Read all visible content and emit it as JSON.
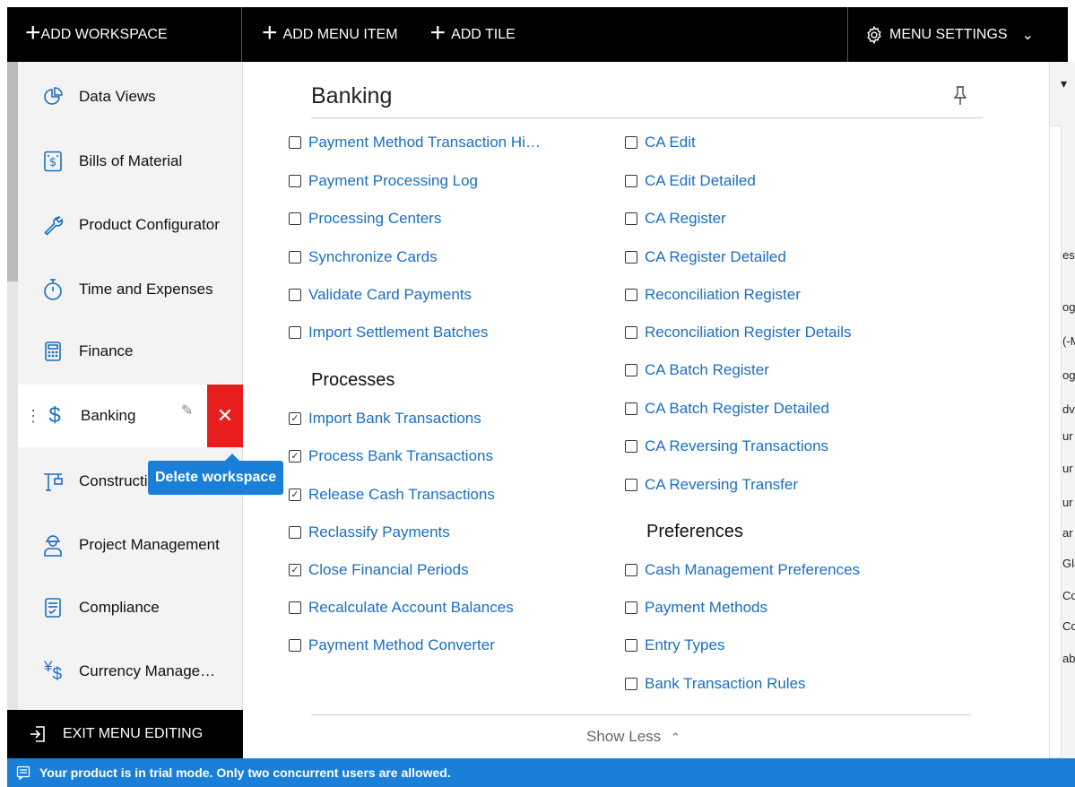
{
  "topbar": {
    "add_workspace": "ADD WORKSPACE",
    "add_menu_item": "ADD MENU ITEM",
    "add_tile": "ADD TILE",
    "menu_settings": "MENU SETTINGS"
  },
  "sidebar": {
    "items": [
      {
        "label": "Data Views",
        "icon": "pie-chart-icon"
      },
      {
        "label": "Bills of Material",
        "icon": "bill-icon"
      },
      {
        "label": "Product Configurator",
        "icon": "wrench-icon"
      },
      {
        "label": "Time and Expenses",
        "icon": "stopwatch-icon"
      },
      {
        "label": "Finance",
        "icon": "calculator-icon"
      },
      {
        "label": "Banking",
        "icon": "dollar-icon"
      },
      {
        "label": "Construction",
        "icon": "crane-icon"
      },
      {
        "label": "Project Management",
        "icon": "engineer-icon"
      },
      {
        "label": "Compliance",
        "icon": "checklist-icon"
      },
      {
        "label": "Currency Manage…",
        "icon": "currency-icon"
      }
    ],
    "tooltip": "Delete workspace",
    "exit_label": "EXIT MENU EDITING"
  },
  "workspace": {
    "title": "Banking",
    "col1": [
      {
        "label": "Payment Method Transaction Hi…",
        "checked": false
      },
      {
        "label": "Payment Processing Log",
        "checked": false
      },
      {
        "label": "Processing Centers",
        "checked": false
      },
      {
        "label": "Synchronize Cards",
        "checked": false
      },
      {
        "label": "Validate Card Payments",
        "checked": false
      },
      {
        "label": "Import Settlement Batches",
        "checked": false
      }
    ],
    "processes_heading": "Processes",
    "processes": [
      {
        "label": "Import Bank Transactions",
        "checked": true
      },
      {
        "label": "Process Bank Transactions",
        "checked": true
      },
      {
        "label": "Release Cash Transactions",
        "checked": true
      },
      {
        "label": "Reclassify Payments",
        "checked": false
      },
      {
        "label": "Close Financial Periods",
        "checked": true
      },
      {
        "label": "Recalculate Account Balances",
        "checked": false
      },
      {
        "label": "Payment Method Converter",
        "checked": false
      }
    ],
    "col2": [
      {
        "label": "CA Edit",
        "checked": false
      },
      {
        "label": "CA Edit Detailed",
        "checked": false
      },
      {
        "label": "CA Register",
        "checked": false
      },
      {
        "label": "CA Register Detailed",
        "checked": false
      },
      {
        "label": "Reconciliation Register",
        "checked": false
      },
      {
        "label": "Reconciliation Register Details",
        "checked": false
      },
      {
        "label": "CA Batch Register",
        "checked": false
      },
      {
        "label": "CA Batch Register Detailed",
        "checked": false
      },
      {
        "label": "CA Reversing Transactions",
        "checked": false
      },
      {
        "label": "CA Reversing Transfer",
        "checked": false
      }
    ],
    "preferences_heading": "Preferences",
    "preferences": [
      {
        "label": "Cash Management Preferences",
        "checked": false
      },
      {
        "label": "Payment Methods",
        "checked": false
      },
      {
        "label": "Entry Types",
        "checked": false
      },
      {
        "label": "Bank Transaction Rules",
        "checked": false
      }
    ],
    "show_less": "Show Less"
  },
  "right_edge_fragments": [
    "esc",
    "og",
    "(-M",
    "og",
    "dv",
    "ur",
    "ur",
    "ur",
    "ar",
    "Gla",
    "Cor",
    "Cor",
    "ab"
  ],
  "status": "Your product is in trial mode. Only two concurrent users are allowed.",
  "colors": {
    "link": "#1b6ec2",
    "delete": "#e81e1e",
    "status_bar": "#1a7fd8",
    "topbar": "#000000"
  }
}
